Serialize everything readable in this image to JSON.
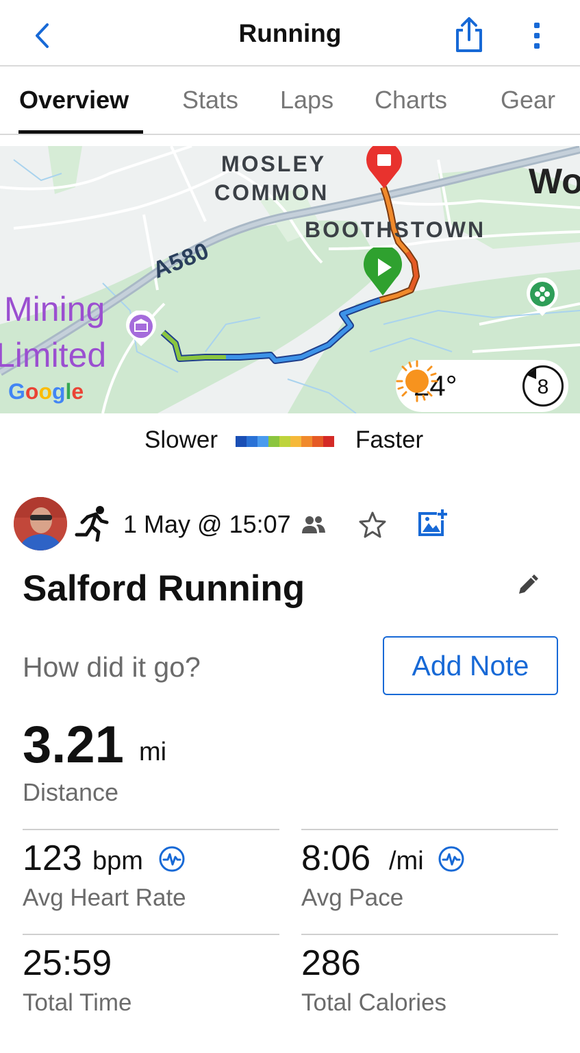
{
  "header": {
    "title": "Running"
  },
  "tabs": [
    {
      "label": "Overview"
    },
    {
      "label": "Stats"
    },
    {
      "label": "Laps"
    },
    {
      "label": "Charts"
    },
    {
      "label": "Gear"
    }
  ],
  "map": {
    "labels": [
      "MOSLEY",
      "COMMON",
      "BOOTHSTOWN",
      "A580",
      "Wo"
    ],
    "place": {
      "line1": "Mining",
      "line2": "Limited"
    },
    "attribution": "Google",
    "weather": {
      "temperature": "24°",
      "wind": "8"
    }
  },
  "legend": {
    "slower": "Slower",
    "faster": "Faster",
    "colors": [
      "#1a4fb5",
      "#2a72d6",
      "#4a9bee",
      "#8bc53f",
      "#bed43c",
      "#f5b93a",
      "#f08a2c",
      "#e55a25",
      "#d42a26"
    ]
  },
  "activity": {
    "date": "1 May @ 15:07",
    "title": "Salford Running",
    "prompt": "How did it go?",
    "add_note": "Add Note"
  },
  "distance": {
    "value": "3.21",
    "unit": "mi",
    "label": "Distance"
  },
  "stats": {
    "heart_rate": {
      "value": "123",
      "unit": "bpm",
      "label": "Avg Heart Rate"
    },
    "pace": {
      "value": "8:06",
      "unit": "/mi",
      "label": "Avg Pace"
    },
    "time": {
      "value": "25:59",
      "label": "Total Time"
    },
    "calories": {
      "value": "286",
      "label": "Total Calories"
    }
  },
  "colors": {
    "accent": "#1769d6",
    "start": "#2fa12f",
    "finish": "#e8322e"
  }
}
